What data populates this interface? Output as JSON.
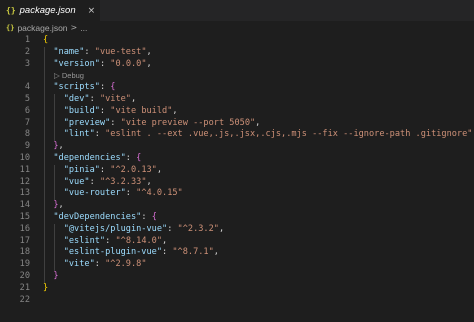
{
  "tab": {
    "icon": "{}",
    "label": "package.json",
    "close": "×"
  },
  "breadcrumb": {
    "icon": "{}",
    "file": "package.json",
    "separator": ">",
    "more": "..."
  },
  "codelens": {
    "label": "▷ Debug"
  },
  "lines": [
    {
      "n": "1",
      "segs": [
        [
          "brace",
          "{"
        ]
      ]
    },
    {
      "n": "2",
      "segs": [
        [
          "pun",
          "  "
        ],
        [
          "key",
          "\"name\""
        ],
        [
          "pun",
          ": "
        ],
        [
          "str",
          "\"vue-test\""
        ],
        [
          "pun",
          ","
        ]
      ]
    },
    {
      "n": "3",
      "segs": [
        [
          "pun",
          "  "
        ],
        [
          "key",
          "\"version\""
        ],
        [
          "pun",
          ": "
        ],
        [
          "str",
          "\"0.0.0\""
        ],
        [
          "pun",
          ","
        ]
      ]
    },
    {
      "n": "4",
      "segs": [
        [
          "pun",
          "  "
        ],
        [
          "key",
          "\"scripts\""
        ],
        [
          "pun",
          ": "
        ],
        [
          "brace2",
          "{"
        ]
      ]
    },
    {
      "n": "5",
      "segs": [
        [
          "pun",
          "    "
        ],
        [
          "key",
          "\"dev\""
        ],
        [
          "pun",
          ": "
        ],
        [
          "str",
          "\"vite\""
        ],
        [
          "pun",
          ","
        ]
      ]
    },
    {
      "n": "6",
      "segs": [
        [
          "pun",
          "    "
        ],
        [
          "key",
          "\"build\""
        ],
        [
          "pun",
          ": "
        ],
        [
          "str",
          "\"vite build\""
        ],
        [
          "pun",
          ","
        ]
      ]
    },
    {
      "n": "7",
      "segs": [
        [
          "pun",
          "    "
        ],
        [
          "key",
          "\"preview\""
        ],
        [
          "pun",
          ": "
        ],
        [
          "str",
          "\"vite preview --port 5050\""
        ],
        [
          "pun",
          ","
        ]
      ]
    },
    {
      "n": "8",
      "segs": [
        [
          "pun",
          "    "
        ],
        [
          "key",
          "\"lint\""
        ],
        [
          "pun",
          ": "
        ],
        [
          "str",
          "\"eslint . --ext .vue,.js,.jsx,.cjs,.mjs --fix --ignore-path .gitignore\""
        ]
      ]
    },
    {
      "n": "9",
      "segs": [
        [
          "pun",
          "  "
        ],
        [
          "brace2",
          "}"
        ],
        [
          "pun",
          ","
        ]
      ]
    },
    {
      "n": "10",
      "segs": [
        [
          "pun",
          "  "
        ],
        [
          "key",
          "\"dependencies\""
        ],
        [
          "pun",
          ": "
        ],
        [
          "brace2",
          "{"
        ]
      ]
    },
    {
      "n": "11",
      "segs": [
        [
          "pun",
          "    "
        ],
        [
          "key",
          "\"pinia\""
        ],
        [
          "pun",
          ": "
        ],
        [
          "str",
          "\"^2.0.13\""
        ],
        [
          "pun",
          ","
        ]
      ]
    },
    {
      "n": "12",
      "segs": [
        [
          "pun",
          "    "
        ],
        [
          "key",
          "\"vue\""
        ],
        [
          "pun",
          ": "
        ],
        [
          "str",
          "\"^3.2.33\""
        ],
        [
          "pun",
          ","
        ]
      ]
    },
    {
      "n": "13",
      "segs": [
        [
          "pun",
          "    "
        ],
        [
          "key",
          "\"vue-router\""
        ],
        [
          "pun",
          ": "
        ],
        [
          "str",
          "\"^4.0.15\""
        ]
      ]
    },
    {
      "n": "14",
      "segs": [
        [
          "pun",
          "  "
        ],
        [
          "brace2",
          "}"
        ],
        [
          "pun",
          ","
        ]
      ]
    },
    {
      "n": "15",
      "segs": [
        [
          "pun",
          "  "
        ],
        [
          "key",
          "\"devDependencies\""
        ],
        [
          "pun",
          ": "
        ],
        [
          "brace2",
          "{"
        ]
      ]
    },
    {
      "n": "16",
      "segs": [
        [
          "pun",
          "    "
        ],
        [
          "key",
          "\"@vitejs/plugin-vue\""
        ],
        [
          "pun",
          ": "
        ],
        [
          "str",
          "\"^2.3.2\""
        ],
        [
          "pun",
          ","
        ]
      ]
    },
    {
      "n": "17",
      "segs": [
        [
          "pun",
          "    "
        ],
        [
          "key",
          "\"eslint\""
        ],
        [
          "pun",
          ": "
        ],
        [
          "str",
          "\"^8.14.0\""
        ],
        [
          "pun",
          ","
        ]
      ]
    },
    {
      "n": "18",
      "segs": [
        [
          "pun",
          "    "
        ],
        [
          "key",
          "\"eslint-plugin-vue\""
        ],
        [
          "pun",
          ": "
        ],
        [
          "str",
          "\"^8.7.1\""
        ],
        [
          "pun",
          ","
        ]
      ]
    },
    {
      "n": "19",
      "segs": [
        [
          "pun",
          "    "
        ],
        [
          "key",
          "\"vite\""
        ],
        [
          "pun",
          ": "
        ],
        [
          "str",
          "\"^2.9.8\""
        ]
      ]
    },
    {
      "n": "20",
      "segs": [
        [
          "pun",
          "  "
        ],
        [
          "brace2",
          "}"
        ]
      ]
    },
    {
      "n": "21",
      "segs": [
        [
          "brace",
          "}"
        ]
      ]
    },
    {
      "n": "22",
      "segs": []
    }
  ],
  "colors": {
    "background": "#1e1e1e",
    "key": "#9cdcfe",
    "string": "#ce9178",
    "bracket_level1": "#ffd700",
    "bracket_level2": "#da70d6",
    "line_number": "#858585"
  }
}
